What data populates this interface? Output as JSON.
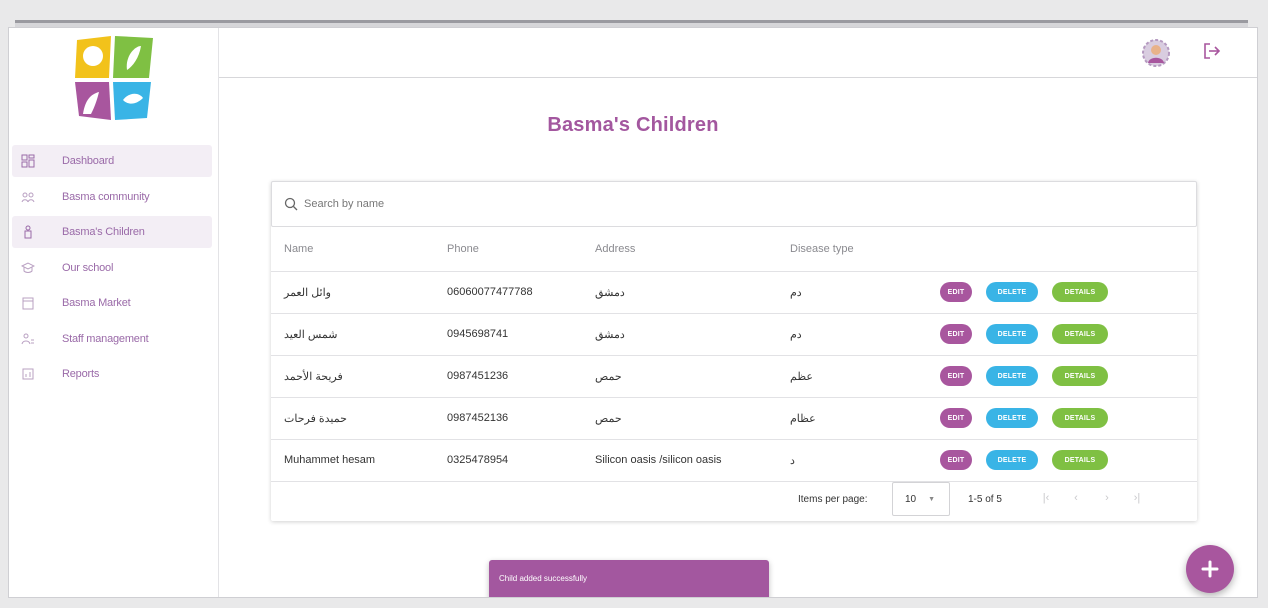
{
  "sidebar": {
    "items": [
      {
        "label": "Dashboard",
        "icon": "dashboard-icon"
      },
      {
        "label": "Basma community",
        "icon": "community-icon"
      },
      {
        "label": "Basma's Children",
        "icon": "child-icon"
      },
      {
        "label": "Our school",
        "icon": "school-icon"
      },
      {
        "label": "Basma Market",
        "icon": "market-icon"
      },
      {
        "label": "Staff management",
        "icon": "staff-icon"
      },
      {
        "label": "Reports",
        "icon": "reports-icon"
      }
    ]
  },
  "page": {
    "title": "Basma's Children"
  },
  "search": {
    "placeholder": "Search by name"
  },
  "table": {
    "headers": {
      "name": "Name",
      "phone": "Phone",
      "address": "Address",
      "disease": "Disease type"
    },
    "rows": [
      {
        "name": "وائل العمر",
        "phone": "06060077477788",
        "address": "دمشق",
        "disease": "دم"
      },
      {
        "name": "شمس العيد",
        "phone": "0945698741",
        "address": "دمشق",
        "disease": "دم"
      },
      {
        "name": "فريحة الأحمد",
        "phone": "0987451236",
        "address": "حمص",
        "disease": "عظم"
      },
      {
        "name": "حميدة فرحات",
        "phone": "0987452136",
        "address": "حمص",
        "disease": "عظام"
      },
      {
        "name": "Muhammet hesam",
        "phone": "0325478954",
        "address": "Silicon oasis /silicon oasis",
        "disease": "د"
      }
    ],
    "buttons": {
      "edit": "EDIT",
      "delete": "DELETE",
      "details": "DETAILS"
    }
  },
  "paginator": {
    "items_per_page_label": "Items per page:",
    "page_size": "10",
    "range_label": "1-5 of 5"
  },
  "toast": {
    "message": "Child added successfully"
  },
  "colors": {
    "brand": "#a8569e",
    "delete": "#39b4e6",
    "details": "#7fc043"
  }
}
